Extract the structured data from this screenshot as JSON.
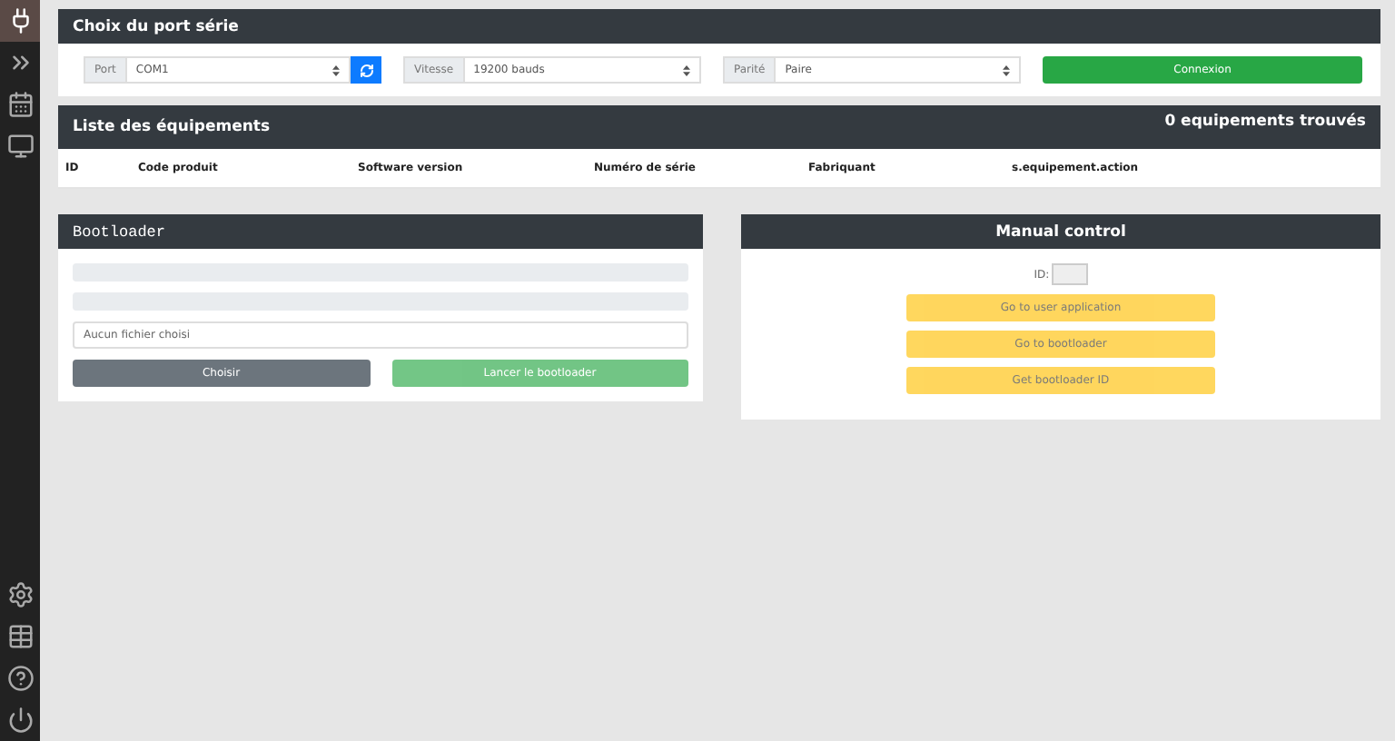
{
  "sidebar": {
    "top_items": [
      {
        "selected": true
      },
      {
        "selected": false
      },
      {
        "selected": false
      },
      {
        "selected": false
      }
    ],
    "bottom_items": [
      {
        "selected": false
      },
      {
        "selected": false
      },
      {
        "selected": false
      },
      {
        "selected": false
      }
    ]
  },
  "port_panel": {
    "title": "Choix du port série",
    "fields": [
      {
        "label": "Port",
        "value": "COM1",
        "refresh": true
      },
      {
        "label": "Vitesse",
        "value": "19200 bauds",
        "refresh": false
      },
      {
        "label": "Parité",
        "value": "Paire",
        "refresh": false
      }
    ],
    "connect_button": "Connexion"
  },
  "devices_panel": {
    "title": "Liste des équipements",
    "count": "0 equipements trouvés",
    "columns": [
      "ID",
      "Code produit",
      "Software version",
      "Numéro de série",
      "Fabriquant",
      "s.equipement.action"
    ]
  },
  "bootloader": {
    "title": "Bootloader",
    "progress": [
      {
        "level": 0
      },
      {
        "level": 0
      }
    ],
    "file_placeholder": "Aucun fichier choisi",
    "choose_button": "Choisir",
    "launch_button": "Lancer le bootloader",
    "launch_disabled": true
  },
  "manual_control": {
    "title": "Manual control",
    "id_label": "ID:",
    "buttons": [
      {
        "label": "Go to user application",
        "disabled": true
      },
      {
        "label": "Go to bootloader",
        "disabled": true
      },
      {
        "label": "Get bootloader ID",
        "disabled": true
      }
    ]
  }
}
